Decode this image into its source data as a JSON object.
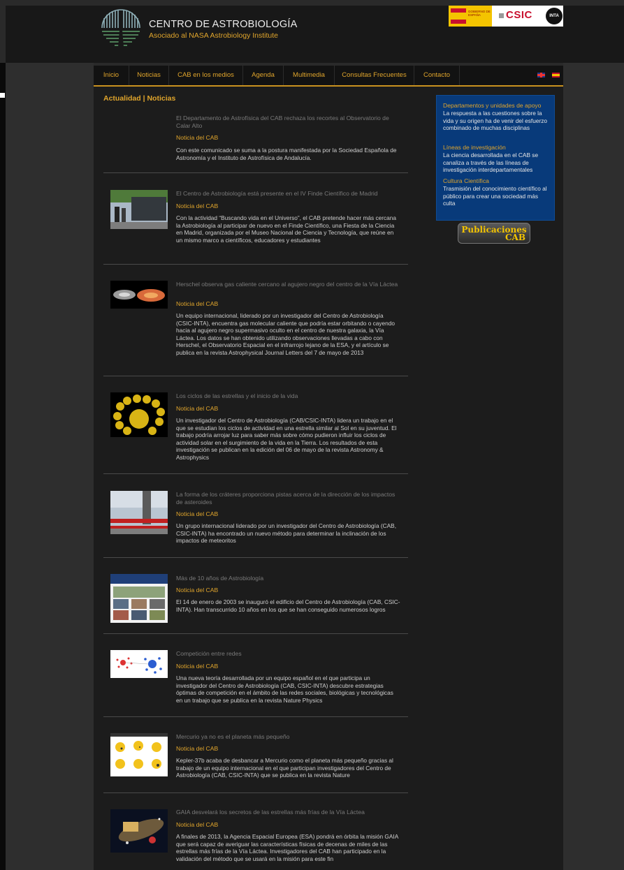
{
  "header": {
    "title": "CENTRO DE ASTROBIOLOGÍA",
    "subtitle": "Asociado al NASA Astrobiology Institute",
    "partners": {
      "gobierno": "GOBIERNO DE ESPAÑA",
      "csic": "CSIC",
      "inta": "INTA"
    }
  },
  "nav": {
    "items": [
      "Inicio",
      "Noticias",
      "CAB en los medios",
      "Agenda",
      "Multimedia",
      "Consultas Frecuentes",
      "Contacto"
    ],
    "lang_icons": [
      "flag-en-icon",
      "flag-es-icon"
    ]
  },
  "section_title": "Actualidad | Noticias",
  "news": [
    {
      "title": "El Departamento de Astrofísica del CAB rechaza los recortes al Observatorio de Calar Alto",
      "source": "Noticia del CAB",
      "body": "Con este comunicado se suma a la postura manifestada por la Sociedad Española de Astronomía y el Instituto de Astrofísica de Andalucía."
    },
    {
      "title": "El Centro de Astrobiología está presente en el IV Finde Científico de Madrid",
      "source": "Noticia del CAB",
      "body": "Con la actividad “Buscando vida en el Universo”, el CAB pretende hacer más cercana la Astrobiología al participar de nuevo en el Finde Científico, una Fiesta de la Ciencia en Madrid, organizada por el Museo Nacional de Ciencia y Tecnología, que reúne en un mismo marco a científicos, educadores y estudiantes"
    },
    {
      "title": "Herschel observa gas caliente cercano al agujero negro del centro de la Vía Láctea",
      "source": "Noticia del CAB",
      "body": "Un equipo internacional, liderado por un investigador del Centro de Astrobiología (CSIC-INTA), encuentra gas molecular caliente que podría estar orbitando o cayendo hacia al agujero negro supermasivo oculto en el centro de nuestra galaxia, la Vía Láctea. Los datos se han obtenido utilizando observaciones llevadas a cabo con Herschel, el Observatorio Espacial en el infrarrojo lejano de la ESA, y el artículo se publica en la revista Astrophysical Journal Letters del 7 de mayo de 2013"
    },
    {
      "title": "Los ciclos de las estrellas y el inicio de la vida",
      "source": "Noticia del CAB",
      "body": "Un investigador del Centro de Astrobiología (CAB/CSIC-INTA) lidera un trabajo en el que se estudian los ciclos de actividad en una estrella similar al Sol en su juventud. El trabajo podría arrojar luz para saber más sobre cómo pudieron influir los ciclos de actividad solar en el surgimiento de la vida en la Tierra. Los resultados de esta investigación se publican en la edición del 06 de mayo de la revista Astronomy & Astrophysics"
    },
    {
      "title": "La forma de los cráteres proporciona pistas acerca de la dirección de los impactos de asteroides",
      "source": "Noticia del CAB",
      "body": "Un grupo internacional liderado por un investigador del Centro de Astrobiología (CAB, CSIC-INTA) ha encontrado un nuevo método para determinar la inclinación de los impactos de meteoritos"
    },
    {
      "title": "Más de 10 años de Astrobiología",
      "source": "Noticia del CAB",
      "body": "El 14 de enero de 2003 se inauguró el edificio del Centro de Astrobiología (CAB, CSIC-INTA). Han transcurrido 10 años en los que se han conseguido numerosos logros"
    },
    {
      "title": "Competición entre redes",
      "source": "Noticia del CAB",
      "body": "Una nueva teoría desarrollada por un equipo español en el que participa un investigador del Centro de Astrobiología (CAB, CSIC-INTA) descubre estrategias óptimas de competición en el ámbito de las redes sociales, biológicas y tecnológicas en un trabajo que se publica en la revista Nature Physics"
    },
    {
      "title": "Mercurio ya no es el planeta más pequeño",
      "source": "Noticia del CAB",
      "body": "Kepler-37b acaba de desbancar a Mercurio como el planeta más pequeño gracias al trabajo de un equipo internacional en el que participan investigadores del Centro de Astrobiología (CAB, CSIC-INTA) que se publica en la revista Nature"
    },
    {
      "title": "GAIA desvelará los secretos de las estrellas más frías de la Vía Láctea",
      "source": "Noticia del CAB",
      "body": "A finales de 2013, la Agencia Espacial Europea (ESA) pondrá en órbita la misión GAIA que será capaz de averiguar las características físicas de decenas de miles de las estrellas más frías de la Vía Láctea. Investigadores del CAB han participado en la validación del método que se usará en la misión para este fin"
    }
  ],
  "sidebar": {
    "blocks": [
      {
        "heading": "Departamentos y unidades de apoyo",
        "text": "La respuesta a las cuestiones sobre la vida y su origen ha de venir del esfuerzo combinado de muchas disciplinas"
      },
      {
        "heading": "Líneas de investigación",
        "text": "La ciencia desarrollada en el CAB se canaliza a través de las líneas de investigación interdepartamentales"
      },
      {
        "heading": "Cultura Científica",
        "text": "Trasmisión del conocimiento científico al público para crear una sociedad más culta"
      }
    ],
    "publicaciones": {
      "line1": "Publicaciones",
      "line2": "CAB"
    }
  }
}
